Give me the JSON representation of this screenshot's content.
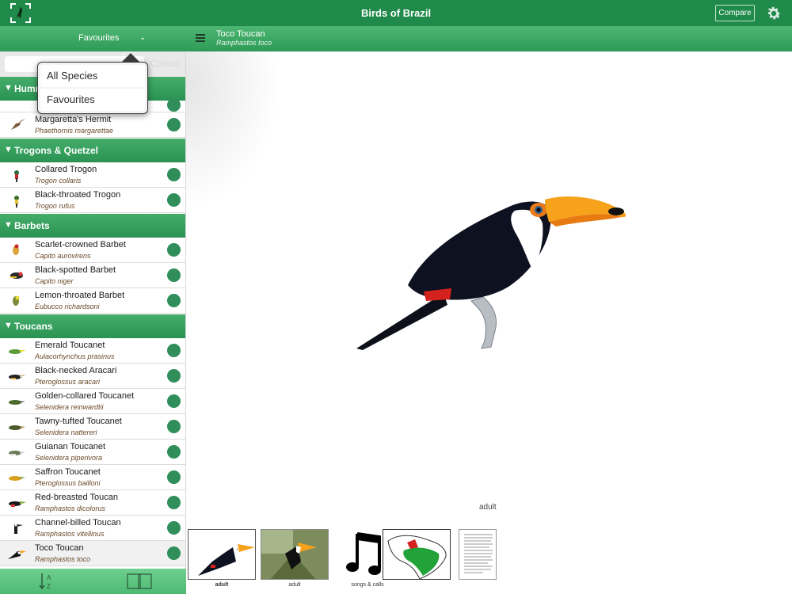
{
  "app": {
    "title": "Birds of Brazil",
    "compare_label": "Compare"
  },
  "filter": {
    "selected": "Favourites",
    "cancel_label": "Cancel"
  },
  "popover": {
    "items": [
      "All Species",
      "Favourites"
    ]
  },
  "detail": {
    "common_name": "Toco Toucan",
    "scientific_name": "Ramphastos toco",
    "image_caption": "adult",
    "thumbnails": [
      {
        "caption": "adult",
        "kind": "illustration"
      },
      {
        "caption": "adult",
        "kind": "photo"
      },
      {
        "caption": "songs & calls",
        "kind": "music-note"
      },
      {
        "caption": "",
        "kind": "map"
      },
      {
        "caption": "",
        "kind": "text"
      }
    ]
  },
  "sections": [
    {
      "label": "Hummingbirds"
    },
    {
      "label": "Trogons & Quetzel"
    },
    {
      "label": "Barbets"
    },
    {
      "label": "Toucans"
    }
  ],
  "species": [
    {
      "common": "Margaretta's Hermit",
      "scientific": "Phaethornis margarettae"
    },
    {
      "common": "Collared Trogon",
      "scientific": "Trogon collaris"
    },
    {
      "common": "Black-throated Trogon",
      "scientific": "Trogon rufus"
    },
    {
      "common": "Scarlet-crowned Barbet",
      "scientific": "Capito aurovirens"
    },
    {
      "common": "Black-spotted Barbet",
      "scientific": "Capito niger"
    },
    {
      "common": "Lemon-throated Barbet",
      "scientific": "Eubucco richardsoni"
    },
    {
      "common": "Emerald Toucanet",
      "scientific": "Aulacorhynchus prasinus"
    },
    {
      "common": "Black-necked Aracari",
      "scientific": "Pteroglossus aracari"
    },
    {
      "common": "Golden-collared Toucanet",
      "scientific": "Selenidera reinwardtii"
    },
    {
      "common": "Tawny-tufted Toucanet",
      "scientific": "Selenidera nattereri"
    },
    {
      "common": "Guianan Toucanet",
      "scientific": "Selenidera piperivora"
    },
    {
      "common": "Saffron Toucanet",
      "scientific": "Pteroglossus bailloni"
    },
    {
      "common": "Red-breasted Toucan",
      "scientific": "Ramphastos dicolorus"
    },
    {
      "common": "Channel-billed Toucan",
      "scientific": "Ramphastos vitellinus"
    },
    {
      "common": "Toco Toucan",
      "scientific": "Ramphastos toco"
    }
  ],
  "colors": {
    "brand_green": "#1f8a4a",
    "favourite_dot": "#2f8e5a",
    "toucan_bill": "#f7a21b"
  }
}
